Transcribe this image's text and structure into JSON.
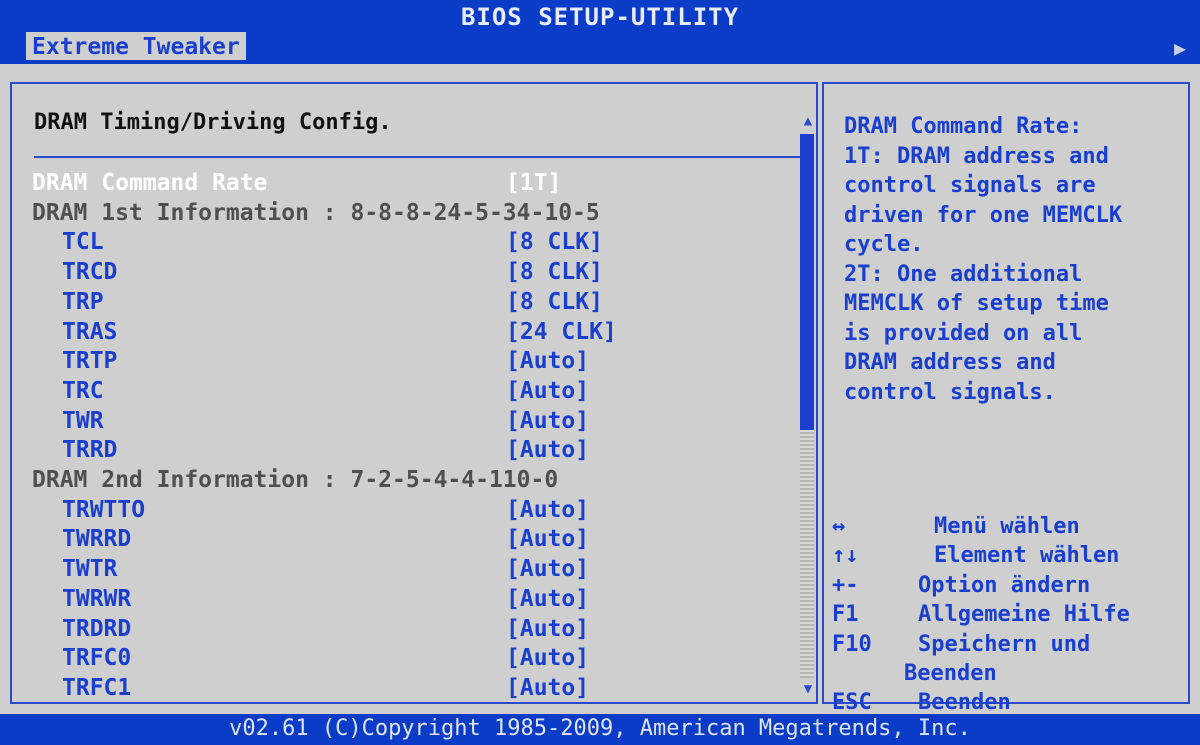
{
  "window_title": "BIOS SETUP-UTILITY",
  "menu": {
    "active_tab": "Extreme Tweaker",
    "arrow": "▶"
  },
  "section_title": "DRAM Timing/Driving Config.",
  "rows": [
    {
      "label": "DRAM Command Rate",
      "value": "[1T]",
      "kind": "sel"
    },
    {
      "label": "DRAM 1st Information : 8-8-8-24-5-34-10-5",
      "value": "",
      "kind": "info"
    },
    {
      "label": "TCL",
      "value": "[8 CLK]",
      "kind": "sub"
    },
    {
      "label": "TRCD",
      "value": "[8 CLK]",
      "kind": "sub"
    },
    {
      "label": "TRP",
      "value": "[8 CLK]",
      "kind": "sub"
    },
    {
      "label": "TRAS",
      "value": "[24 CLK]",
      "kind": "sub"
    },
    {
      "label": "TRTP",
      "value": "[Auto]",
      "kind": "sub"
    },
    {
      "label": "TRC",
      "value": "[Auto]",
      "kind": "sub"
    },
    {
      "label": "TWR",
      "value": "[Auto]",
      "kind": "sub"
    },
    {
      "label": "TRRD",
      "value": "[Auto]",
      "kind": "sub"
    },
    {
      "label": "DRAM 2nd Information : 7-2-5-4-4-110-0",
      "value": "",
      "kind": "info"
    },
    {
      "label": "TRWTTO",
      "value": "[Auto]",
      "kind": "sub"
    },
    {
      "label": "TWRRD",
      "value": "[Auto]",
      "kind": "sub"
    },
    {
      "label": "TWTR",
      "value": "[Auto]",
      "kind": "sub"
    },
    {
      "label": "TWRWR",
      "value": "[Auto]",
      "kind": "sub"
    },
    {
      "label": "TRDRD",
      "value": "[Auto]",
      "kind": "sub"
    },
    {
      "label": "TRFC0",
      "value": "[Auto]",
      "kind": "sub"
    },
    {
      "label": "TRFC1",
      "value": "[Auto]",
      "kind": "sub"
    }
  ],
  "scrollbar": {
    "up_icon": "▲",
    "down_icon": "▼"
  },
  "help_lines": [
    "DRAM Command Rate:",
    "1T: DRAM address and",
    "control signals are",
    "driven for one MEMCLK",
    "cycle.",
    "2T: One additional",
    "MEMCLK of setup time",
    "is provided on all",
    "DRAM address and",
    "control signals."
  ],
  "keys": [
    {
      "key": "↔",
      "desc": "Menü wählen"
    },
    {
      "key": "↑↓",
      "desc": "Element wählen"
    },
    {
      "key": "+-",
      "desc": "Option ändern"
    },
    {
      "key": "F1",
      "desc": "Allgemeine Hilfe"
    },
    {
      "key": "F10",
      "desc": "Speichern und"
    },
    {
      "key": "",
      "desc": "Beenden"
    },
    {
      "key": "ESC",
      "desc": "Beenden"
    }
  ],
  "footer": "v02.61 (C)Copyright 1985-2009, American Megatrends, Inc.",
  "colors": {
    "background_blue": "#0a3cc8",
    "panel_grey": "#cfcfcf",
    "item_blue": "#1a3fcf",
    "selected_white": "#ffffff",
    "info_grey": "#505050"
  }
}
